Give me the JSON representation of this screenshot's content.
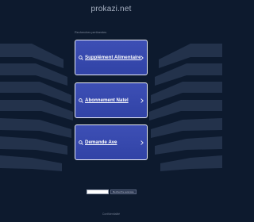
{
  "header": {
    "domain": "prokazi.net"
  },
  "main": {
    "related_label": "Recherches pertinentes",
    "results": [
      {
        "label": "Supplément Alimentaire"
      },
      {
        "label": "Abonnement Natel"
      },
      {
        "label": "Demande Ave"
      }
    ]
  },
  "search": {
    "button_label": "Recherche avancée",
    "placeholder": ""
  },
  "footer": {
    "text": "Confidentialité"
  },
  "colors": {
    "background": "#0d1a2e",
    "tile": "#3143a6",
    "tile_border": "#e8ebf5",
    "decorative_shape": "#2a3a56"
  }
}
